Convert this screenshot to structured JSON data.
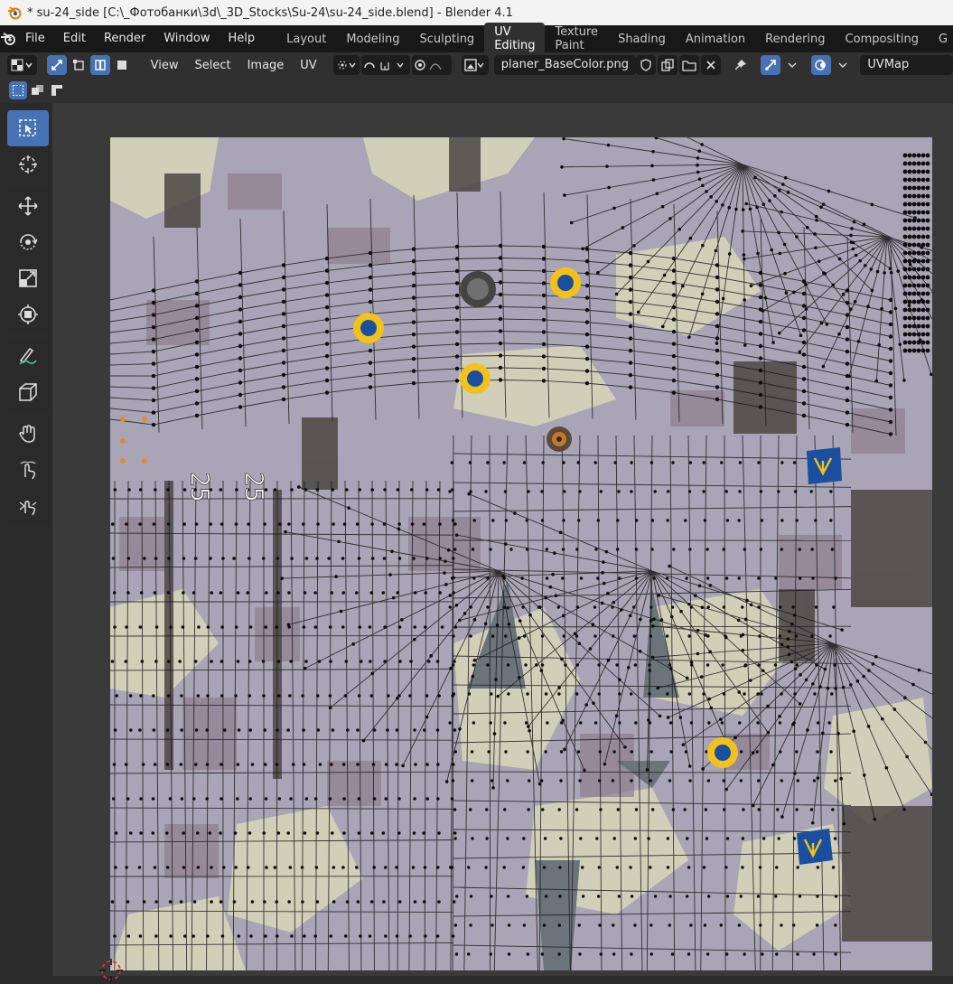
{
  "window": {
    "title": "* su-24_side [C:\\_Фотобанки\\3d\\_3D_Stocks\\Su-24\\su-24_side.blend] - Blender 4.1"
  },
  "menubar": {
    "items": [
      "File",
      "Edit",
      "Render",
      "Window",
      "Help"
    ],
    "workspaces": [
      "Layout",
      "Modeling",
      "Sculpting",
      "UV Editing",
      "Texture Paint",
      "Shading",
      "Animation",
      "Rendering",
      "Compositing",
      "G"
    ],
    "active_workspace": "UV Editing"
  },
  "header": {
    "menus": [
      "View",
      "Select",
      "Image",
      "UV"
    ],
    "image_name": "planer_BaseColor.png",
    "uv_map": "UVMap"
  },
  "colors": {
    "accent": "#4772b3",
    "texture_base": "#a8a4b4",
    "camo_cream": "#d8d6bb",
    "camo_mauve": "#8f7f8e",
    "roundel_yellow": "#f2c21b",
    "roundel_blue": "#1a4fa0"
  },
  "toolbar": {
    "tools": [
      "select-box-icon",
      "cursor-icon",
      "move-icon",
      "rotate-icon",
      "scale-icon",
      "transform-icon",
      "annotate-icon",
      "rip-region-icon",
      "grab-icon",
      "relax-icon",
      "pinch-icon"
    ]
  },
  "texture_labels": [
    "25",
    "25"
  ]
}
